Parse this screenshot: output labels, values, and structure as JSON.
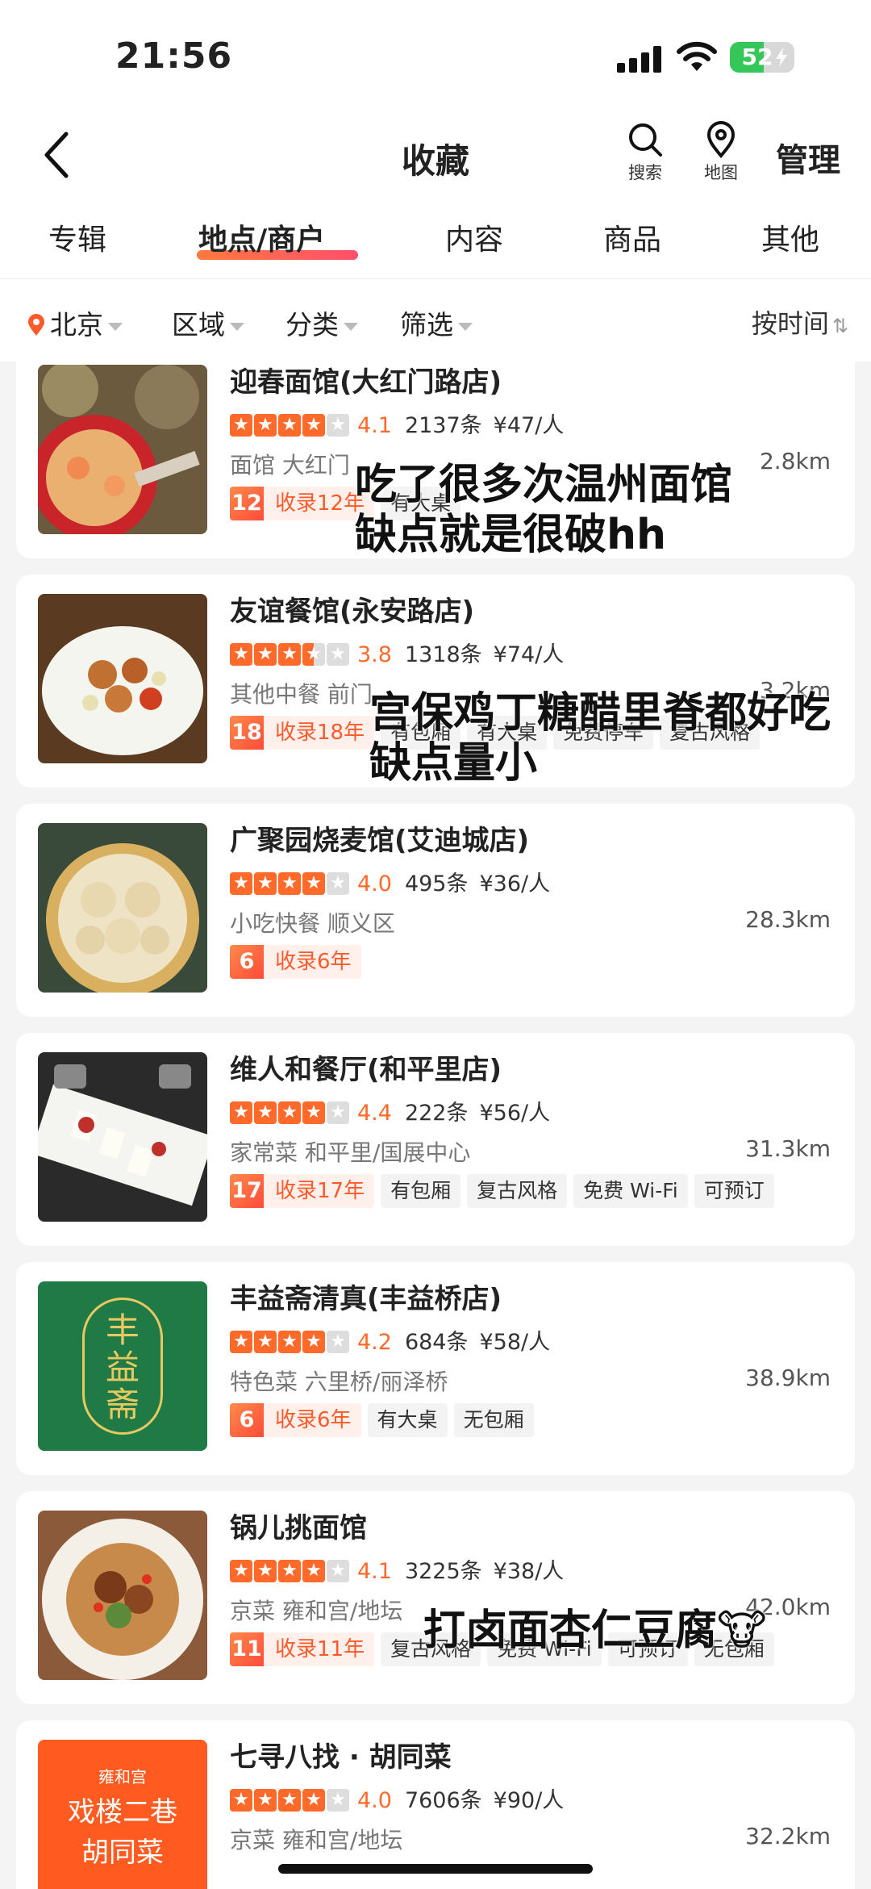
{
  "status": {
    "time": "21:56",
    "battery": "52",
    "battery_level": 0.52
  },
  "nav": {
    "title": "收藏",
    "search_label": "搜索",
    "map_label": "地图",
    "manage": "管理"
  },
  "tabs": [
    {
      "label": "专辑"
    },
    {
      "label": "地点/商户",
      "active": true
    },
    {
      "label": "内容"
    },
    {
      "label": "商品"
    },
    {
      "label": "其他"
    }
  ],
  "filters": {
    "city": "北京",
    "area": "区域",
    "category": "分类",
    "filter": "筛选",
    "sort": "按时间",
    "sort_icon": "⇅"
  },
  "shops": [
    {
      "name": "迎春面馆(大红门路店)",
      "stars": 4,
      "score": "4.1",
      "reviews": "2137条",
      "price": "¥47/人",
      "meta": "面馆 大红门",
      "distance": "2.8km",
      "years_num": "12",
      "years_text": "收录12年",
      "tags": [
        "有大桌"
      ],
      "note": "吃了很多次温州面馆\n缺点就是很破hh"
    },
    {
      "name": "友谊餐馆(永安路店)",
      "stars": 3.5,
      "score": "3.8",
      "reviews": "1318条",
      "price": "¥74/人",
      "meta": "其他中餐 前门",
      "distance": "3.2km",
      "years_num": "18",
      "years_text": "收录18年",
      "tags": [
        "有包厢",
        "有大桌",
        "免费停车",
        "复古风格"
      ],
      "note": "宫保鸡丁糖醋里脊都好吃\n缺点量小"
    },
    {
      "name": "广聚园烧麦馆(艾迪城店)",
      "stars": 4,
      "score": "4.0",
      "reviews": "495条",
      "price": "¥36/人",
      "meta": "小吃快餐 顺义区",
      "distance": "28.3km",
      "years_num": "6",
      "years_text": "收录6年",
      "tags": [],
      "note": ""
    },
    {
      "name": "维人和餐厅(和平里店)",
      "stars": 4,
      "score": "4.4",
      "reviews": "222条",
      "price": "¥56/人",
      "meta": "家常菜 和平里/国展中心",
      "distance": "31.3km",
      "years_num": "17",
      "years_text": "收录17年",
      "tags": [
        "有包厢",
        "复古风格",
        "免费 Wi-Fi",
        "可预订"
      ],
      "note": ""
    },
    {
      "name": "丰益斋清真(丰益桥店)",
      "stars": 4,
      "score": "4.2",
      "reviews": "684条",
      "price": "¥58/人",
      "meta": "特色菜 六里桥/丽泽桥",
      "distance": "38.9km",
      "years_num": "6",
      "years_text": "收录6年",
      "tags": [
        "有大桌",
        "无包厢"
      ],
      "note": "",
      "logo_text": "丰益斋"
    },
    {
      "name": "锅儿挑面馆",
      "stars": 4,
      "score": "4.1",
      "reviews": "3225条",
      "price": "¥38/人",
      "meta": "京菜 雍和宫/地坛",
      "distance": "42.0km",
      "years_num": "11",
      "years_text": "收录11年",
      "tags": [
        "复古风格",
        "免费 Wi-Fi",
        "可预订",
        "无包厢"
      ],
      "note": "打卤面杏仁豆腐🐮"
    },
    {
      "name": "七寻八找 · 胡同菜",
      "stars": 4,
      "score": "4.0",
      "reviews": "7606条",
      "price": "¥90/人",
      "meta": "京菜 雍和宫/地坛",
      "distance": "32.2km",
      "years_num": "",
      "years_text": "",
      "tags": [],
      "note": "",
      "logo_small": "雍和宫",
      "logo_line1": "戏楼二巷",
      "logo_line2": "胡同菜"
    }
  ],
  "colors": {
    "accent": "#ff6a2a",
    "star_off": "#dddddd",
    "logo_green": "#1f7a45",
    "logo_orange": "#ff5a1f"
  }
}
